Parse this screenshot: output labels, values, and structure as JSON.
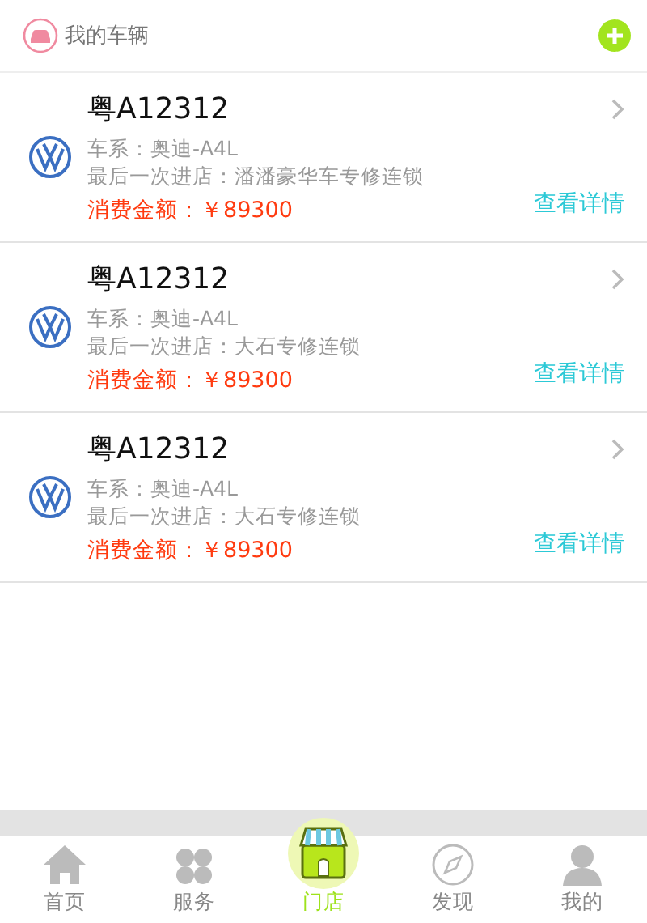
{
  "header": {
    "title": "我的车辆"
  },
  "cars": [
    {
      "plate": "粤A12312",
      "series": "车系：奥迪-A4L",
      "last_store": "最后一次进店：潘潘豪华车专修连锁",
      "amount": "消费金额：￥89300",
      "detail_link": "查看详情"
    },
    {
      "plate": "粤A12312",
      "series": "车系：奥迪-A4L",
      "last_store": "最后一次进店：大石专修连锁",
      "amount": "消费金额：￥89300",
      "detail_link": "查看详情"
    },
    {
      "plate": "粤A12312",
      "series": "车系：奥迪-A4L",
      "last_store": "最后一次进店：大石专修连锁",
      "amount": "消费金额：￥89300",
      "detail_link": "查看详情"
    }
  ],
  "tabs": [
    {
      "label": "首页",
      "selected": false
    },
    {
      "label": "服务",
      "selected": false
    },
    {
      "label": "门店",
      "selected": true
    },
    {
      "label": "发现",
      "selected": false
    },
    {
      "label": "我的",
      "selected": false
    }
  ]
}
